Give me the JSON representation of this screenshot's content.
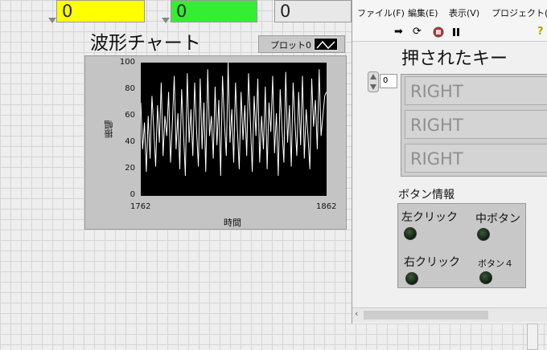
{
  "indicators": [
    {
      "value": "0",
      "color": "#ffff00"
    },
    {
      "value": "0",
      "color": "#33ee33"
    },
    {
      "value": "0",
      "color": "#e8e8e8"
    }
  ],
  "chart": {
    "title": "波形チャート",
    "legend_label": "プロット0",
    "ylabel": "振幅",
    "xlabel": "時間",
    "y_ticks": [
      "100",
      "80",
      "60",
      "40",
      "20",
      "0"
    ],
    "x_ticks": [
      "1762",
      "1862"
    ]
  },
  "chart_data": {
    "type": "line",
    "title": "波形チャート",
    "xlabel": "時間",
    "ylabel": "振幅",
    "xlim": [
      1762,
      1862
    ],
    "ylim": [
      0,
      100
    ],
    "grid": false,
    "series": [
      {
        "name": "プロット0",
        "color": "#ffffff",
        "x": [
          1762,
          1763,
          1764,
          1765,
          1766,
          1767,
          1768,
          1769,
          1770,
          1771,
          1772,
          1773,
          1774,
          1775,
          1776,
          1777,
          1778,
          1779,
          1780,
          1781,
          1782,
          1783,
          1784,
          1785,
          1786,
          1787,
          1788,
          1789,
          1790,
          1791,
          1792,
          1793,
          1794,
          1795,
          1796,
          1797,
          1798,
          1799,
          1800,
          1801,
          1802,
          1803,
          1804,
          1805,
          1806,
          1807,
          1808,
          1809,
          1810,
          1811,
          1812,
          1813,
          1814,
          1815,
          1816,
          1817,
          1818,
          1819,
          1820,
          1821,
          1822,
          1823,
          1824,
          1825,
          1826,
          1827,
          1828,
          1829,
          1830,
          1831,
          1832,
          1833,
          1834,
          1835,
          1836,
          1837,
          1838,
          1839,
          1840,
          1841,
          1842,
          1843,
          1844,
          1845,
          1846,
          1847,
          1848,
          1849,
          1850,
          1851,
          1852,
          1853,
          1854,
          1855,
          1856,
          1857,
          1858,
          1859,
          1860,
          1861,
          1862
        ],
        "values": [
          70,
          35,
          55,
          18,
          60,
          28,
          75,
          50,
          22,
          68,
          40,
          85,
          30,
          60,
          45,
          78,
          25,
          55,
          90,
          35,
          62,
          20,
          80,
          48,
          15,
          92,
          40,
          65,
          30,
          85,
          50,
          22,
          88,
          35,
          70,
          18,
          95,
          45,
          60,
          28,
          82,
          38,
          72,
          15,
          90,
          55,
          30,
          100,
          40,
          65,
          25,
          85,
          50,
          20,
          78,
          42,
          68,
          30,
          92,
          55,
          18,
          75,
          45,
          88,
          25,
          60,
          35,
          82,
          20,
          70,
          48,
          90,
          32,
          62,
          15,
          80,
          50,
          25,
          93,
          40,
          68,
          22,
          85,
          55,
          30,
          78,
          38,
          90,
          28,
          65,
          45,
          20,
          88,
          52,
          72,
          35,
          95,
          45,
          60,
          75,
          78
        ]
      }
    ]
  },
  "window": {
    "menu": [
      "ファイル(F)",
      "編集(E)",
      "表示(V)",
      "プロジェクト(P)"
    ],
    "keys_title": "押されたキー",
    "array_index": "0",
    "keys": [
      "RIGHT",
      "RIGHT",
      "RIGHT"
    ],
    "buttons_title": "ボタン情報",
    "leds": [
      "左クリック",
      "中ボタン",
      "右クリック",
      "ボタン４"
    ]
  }
}
